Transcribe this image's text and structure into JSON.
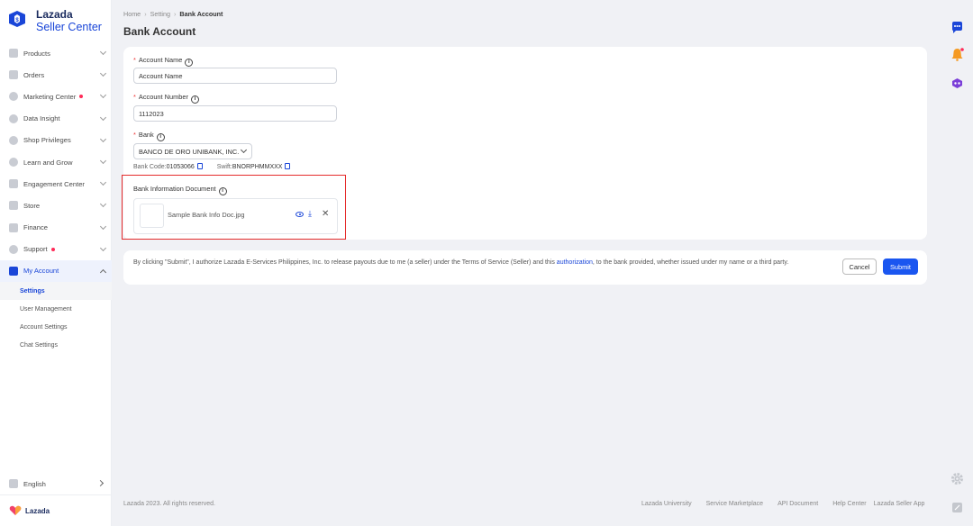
{
  "brand": {
    "name": "Lazada",
    "subtitle": "Seller Center",
    "footer_logo": "Lazada"
  },
  "sidebar": {
    "items": [
      {
        "label": "Products",
        "icon": "products-icon"
      },
      {
        "label": "Orders",
        "icon": "orders-icon"
      },
      {
        "label": "Marketing Center",
        "icon": "marketing-icon",
        "dot": true
      },
      {
        "label": "Data Insight",
        "icon": "data-insight-icon"
      },
      {
        "label": "Shop Privileges",
        "icon": "privileges-icon"
      },
      {
        "label": "Learn and Grow",
        "icon": "learn-icon"
      },
      {
        "label": "Engagement Center",
        "icon": "engagement-icon"
      },
      {
        "label": "Store",
        "icon": "store-icon"
      },
      {
        "label": "Finance",
        "icon": "finance-icon"
      },
      {
        "label": "Support",
        "icon": "support-icon",
        "dot": true
      },
      {
        "label": "My Account",
        "icon": "account-icon",
        "active": true
      }
    ],
    "sub_items": [
      "Settings",
      "User Management",
      "Account Settings",
      "Chat Settings"
    ],
    "language": "English"
  },
  "breadcrumb": {
    "home": "Home",
    "setting": "Setting",
    "current": "Bank Account"
  },
  "page_title": "Bank Account",
  "form": {
    "account_name": {
      "label": "Account Name",
      "value": "Account Name"
    },
    "account_number": {
      "label": "Account Number",
      "value": "1112023"
    },
    "bank": {
      "label": "Bank",
      "value": "BANCO DE ORO UNIBANK, INC."
    },
    "bank_code_label": "Bank Code:",
    "bank_code": "01053066",
    "swift_label": "Swift:",
    "swift": "BNORPHMMXXX",
    "document": {
      "label": "Bank Information Document",
      "file_name": "Sample Bank Info Doc.jpg"
    }
  },
  "consent": {
    "text_before": "By clicking \"Submit\", I authorize Lazada E-Services Philippines, Inc. to release payouts due to me (a seller) under the Terms of Service (Seller) and this ",
    "link": "authorization",
    "text_after": ", to the bank provided, whether issued under my name or a third party.",
    "cancel": "Cancel",
    "submit": "Submit"
  },
  "footer": {
    "copyright": "Lazada 2023. All rights reserved.",
    "links": [
      "Lazada University",
      "Service Marketplace",
      "API Document",
      "Help Center",
      "Lazada Seller App"
    ]
  },
  "colors": {
    "accent": "#1a46d8",
    "submit": "#1a56f0",
    "highlight": "#e52b2b",
    "required": "#e33"
  }
}
